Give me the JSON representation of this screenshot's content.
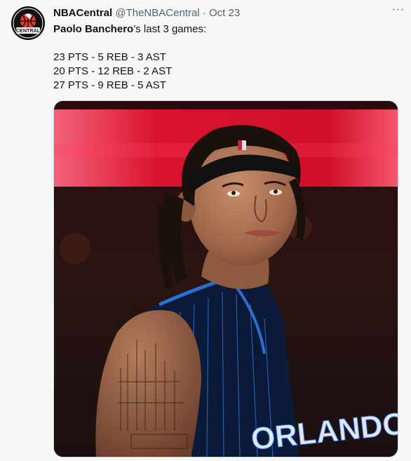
{
  "tweet": {
    "display_name": "NBACentral",
    "handle": "@TheNBACentral",
    "separator": "·",
    "date": "Oct 23",
    "more_label": "···",
    "lead_bold": "Paolo Banchero",
    "lead_rest": "’s last 3 games:",
    "stat_lines": [
      "23 PTS - 5 REB - 3 AST",
      "20 PTS - 12 REB - 2 AST",
      "27 PTS - 9 REB - 5 AST"
    ],
    "avatar_text": "CENTRAL",
    "media_text": "ORLANDO"
  },
  "colors": {
    "background": "#f7f7f7",
    "text": "#0f1419",
    "secondary": "#536471",
    "avatar_ball": "#e03a2f",
    "jersey": "#0c1a3a",
    "jersey_trim": "#2d6fd1",
    "arena_glow": "#e3132f"
  }
}
